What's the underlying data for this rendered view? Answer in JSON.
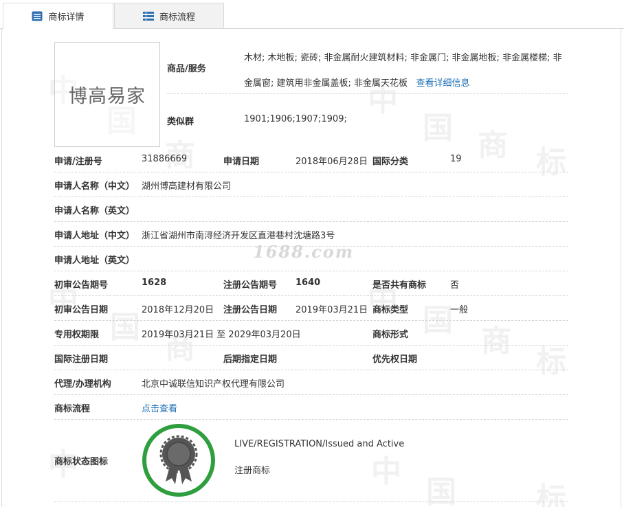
{
  "tabs": {
    "detail": "商标详情",
    "flow": "商标流程"
  },
  "logo": {
    "text": "博高易家"
  },
  "goods": {
    "label": "商品/服务",
    "value": "木材; 木地板; 瓷砖; 非金属耐火建筑材料; 非金属门; 非金属地板; 非金属楼梯; 非金属窗; 建筑用非金属盖板; 非金属天花板",
    "more_link": "查看详细信息"
  },
  "similar_group": {
    "label": "类似群",
    "value": "1901;1906;1907;1909;"
  },
  "application": {
    "reg_no_label": "申请/注册号",
    "reg_no": "31886669",
    "date_label": "申请日期",
    "date": "2018年06月28日",
    "intl_class_label": "国际分类",
    "intl_class": "19"
  },
  "applicant": {
    "name_cn_label": "申请人名称（中文）",
    "name_cn": "湖州博高建材有限公司",
    "name_en_label": "申请人名称（英文）",
    "addr_cn_label": "申请人地址（中文）",
    "addr_cn": "浙江省湖州市南浔经济开发区直港巷村沈塘路3号",
    "addr_en_label": "申请人地址（英文）"
  },
  "announcement": {
    "prelim_no_label": "初审公告期号",
    "prelim_no": "1628",
    "reg_no_label": "注册公告期号",
    "reg_no": "1640",
    "shared_label": "是否共有商标",
    "shared": "否",
    "prelim_date_label": "初审公告日期",
    "prelim_date": "2018年12月20日",
    "reg_date_label": "注册公告日期",
    "reg_date": "2019年03月21日",
    "type_label": "商标类型",
    "type": "一般"
  },
  "rights": {
    "period_label": "专用权期限",
    "period": "2019年03月21日 至 2029年03月20日",
    "form_label": "商标形式",
    "intl_reg_date_label": "国际注册日期",
    "later_designation_label": "后期指定日期",
    "priority_date_label": "优先权日期"
  },
  "agent": {
    "label": "代理/办理机构",
    "value": "北京中诚联信知识产权代理有限公司"
  },
  "process": {
    "label": "商标流程",
    "link": "点击查看"
  },
  "status": {
    "label": "商标状态图标",
    "line1": "LIVE/REGISTRATION/Issued and Active",
    "line2": "注册商标"
  },
  "watermark": {
    "site": "1688.com"
  },
  "colors": {
    "link": "#1a6fb5",
    "badge_ring": "#2e9e3e",
    "badge_medal": "#555555"
  }
}
